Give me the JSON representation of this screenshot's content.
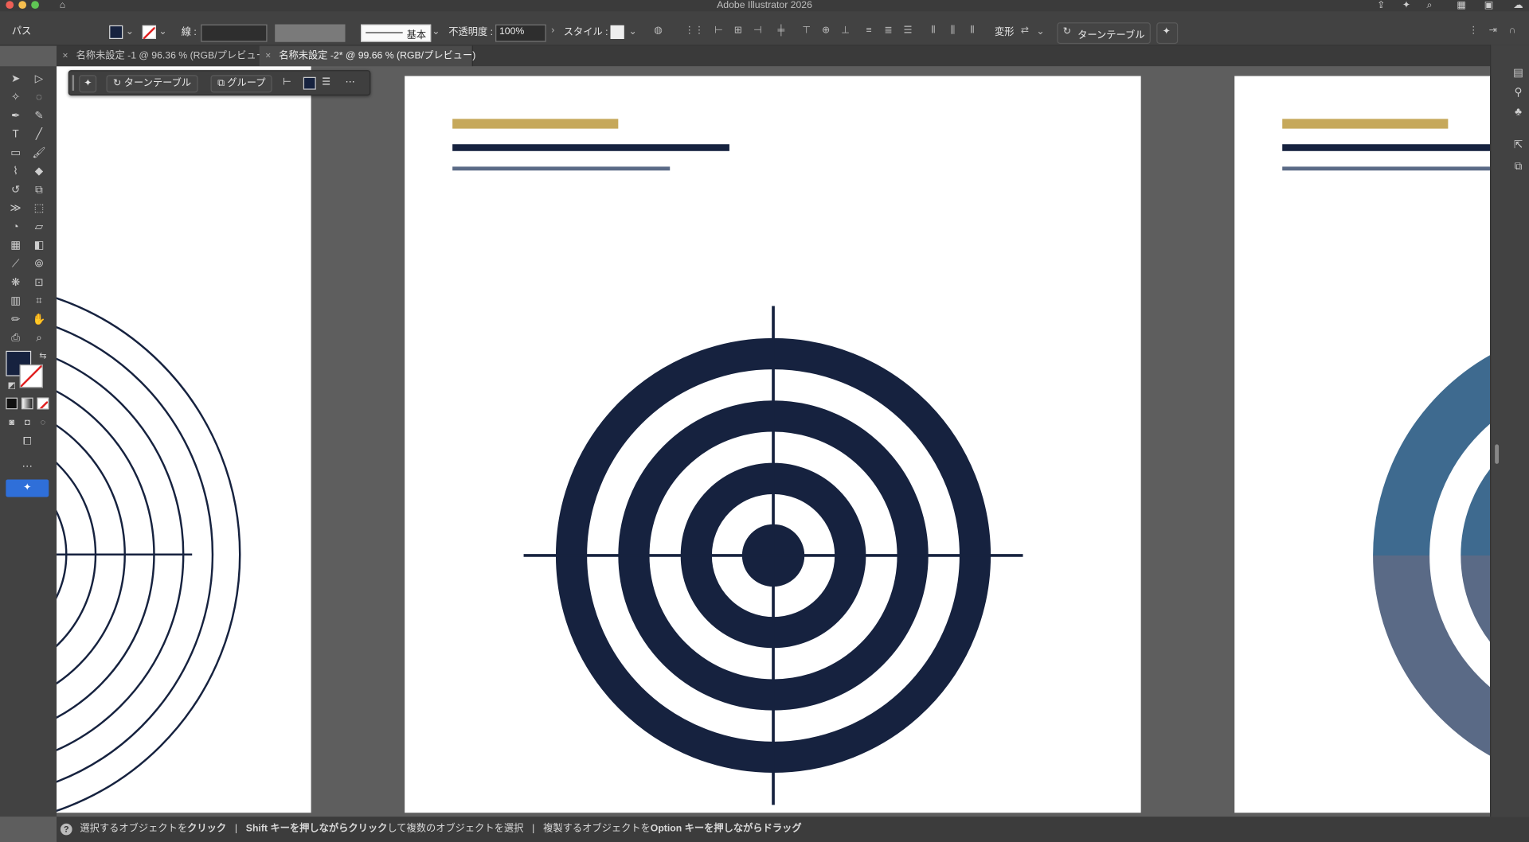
{
  "app": {
    "title": "Adobe Illustrator 2026"
  },
  "control": {
    "selection_type": "パス",
    "stroke_label": "線 :",
    "stroke_profile": "基本",
    "opacity_label": "不透明度 :",
    "opacity_value": "100%",
    "style_label": "スタイル :",
    "transform_label": "変形",
    "turntable_label": "ターンテーブル"
  },
  "tabs": [
    {
      "label": "名称未設定 -1 @ 96.36 % (RGB/プレビュー)"
    },
    {
      "label": "名称未設定 -2* @ 99.66 % (RGB/プレビュー)"
    }
  ],
  "context_bar": {
    "turntable": "ターンテーブル",
    "group": "グループ"
  },
  "status": {
    "p1": "選択するオブジェクトを",
    "p1b": "クリック",
    "sep": "|",
    "p2a": "Shift キーを押しながら",
    "p2b": "クリック",
    "p2c": "して複数のオブジェクトを選択",
    "p3a": "複製するオブジェクトを",
    "p3b": "Option キーを押しながら",
    "p3c": "ドラッグ"
  },
  "colors": {
    "navy": "#16223f",
    "gold": "#c6a85a",
    "slate": "#5a6a86",
    "steel": "#3e6a8f",
    "select_blue": "#2f6fd9"
  },
  "icons": [
    "home-icon",
    "close-icon",
    "turntable-icon",
    "group-icon",
    "more-icon",
    "selection-tool-icon",
    "direct-selection-icon",
    "pen-icon",
    "type-icon",
    "rectangle-icon",
    "brush-icon",
    "rotate-icon",
    "scale-icon",
    "eyedropper-icon",
    "hand-icon",
    "zoom-icon",
    "graph-icon",
    "help-icon"
  ]
}
